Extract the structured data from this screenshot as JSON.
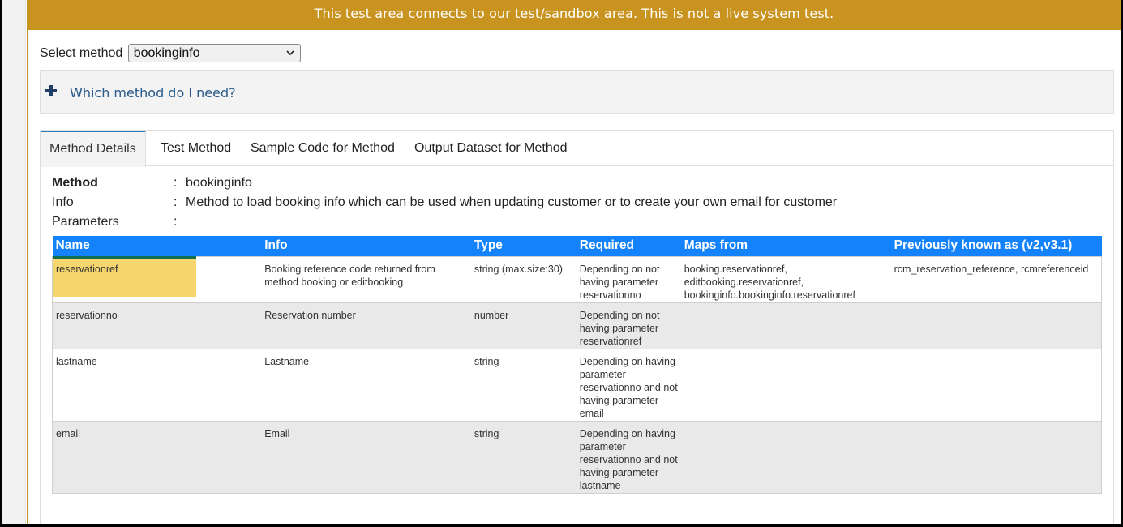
{
  "banner": {
    "text": "This test area connects to our test/sandbox area. This is not a live system test."
  },
  "method_select": {
    "label": "Select method",
    "selected": "bookinginfo"
  },
  "help": {
    "link_text": "Which method do I need?"
  },
  "tabs": [
    {
      "label": "Method Details",
      "active": true
    },
    {
      "label": "Test Method",
      "active": false
    },
    {
      "label": "Sample Code for Method",
      "active": false
    },
    {
      "label": "Output Dataset for Method",
      "active": false
    }
  ],
  "details": {
    "method_label": "Method",
    "method_value": "bookinginfo",
    "info_label": "Info",
    "info_value": "Method to load booking info which can be used when updating customer or to create your own email for customer",
    "params_label": "Parameters",
    "separator": ":"
  },
  "params_table": {
    "headers": [
      "Name",
      "Info",
      "Type",
      "Required",
      "Maps from",
      "Previously known as (v2,v3.1)"
    ],
    "rows": [
      {
        "name": "reservationref",
        "info": "Booking reference code returned from method booking or editbooking",
        "type": "string (max.size:30)",
        "required": "Depending on not having parameter reservationno",
        "maps_from": "booking.reservationref, editbooking.reservationref, bookinginfo.bookinginfo.reservationref",
        "previously": "rcm_reservation_reference, rcmreferenceid"
      },
      {
        "name": "reservationno",
        "info": "Reservation number",
        "type": "number",
        "required": "Depending on not having parameter reservationref",
        "maps_from": "",
        "previously": ""
      },
      {
        "name": "lastname",
        "info": "Lastname",
        "type": "string",
        "required": "Depending on having parameter reservationno and not having parameter email",
        "maps_from": "",
        "previously": ""
      },
      {
        "name": "email",
        "info": "Email",
        "type": "string",
        "required": "Depending on having parameter reservationno and not having parameter lastname",
        "maps_from": "",
        "previously": ""
      }
    ]
  },
  "colors": {
    "banner": "#c8931f",
    "table_header": "#1482fa",
    "highlight": "#f5d56e",
    "link": "#2a5b8a"
  },
  "icons": {
    "select_chevron": "chevron-down-icon",
    "expand": "plus-icon"
  }
}
